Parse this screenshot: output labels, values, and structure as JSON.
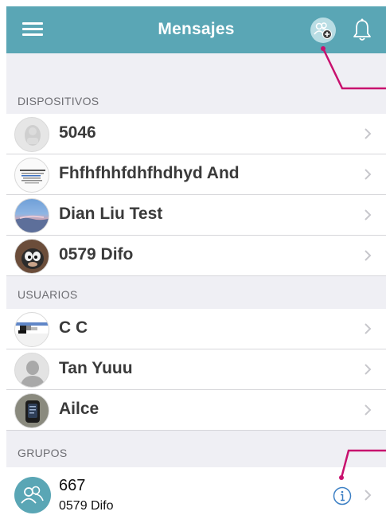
{
  "header": {
    "title": "Mensajes",
    "bar_color": "#5aa6b5"
  },
  "sections": [
    {
      "title": "DISPOSITIVOS",
      "items": [
        {
          "name": "5046",
          "avatar": "placeholder-avatar"
        },
        {
          "name": "Fhfhfhhfdhfhdhyd And",
          "avatar": "document-thumbnail"
        },
        {
          "name": "Dian Liu Test",
          "avatar": "sky-photo"
        },
        {
          "name": "0579 Difo",
          "avatar": "cartoon-photo"
        }
      ]
    },
    {
      "title": "USUARIOS",
      "items": [
        {
          "name": "C C",
          "avatar": "pixelated-photo"
        },
        {
          "name": "Tan Yuuu",
          "avatar": "default-person"
        },
        {
          "name": "Ailce",
          "avatar": "watch-photo"
        }
      ]
    },
    {
      "title": "GRUPOS",
      "groups": [
        {
          "name": "667",
          "subtitle": "0579 Difo",
          "avatar": "group-icon"
        }
      ]
    }
  ],
  "colors": {
    "accent": "#5aa6b5",
    "background": "#efeff4",
    "callout": "#c8116e",
    "info": "#3b7fc4"
  }
}
